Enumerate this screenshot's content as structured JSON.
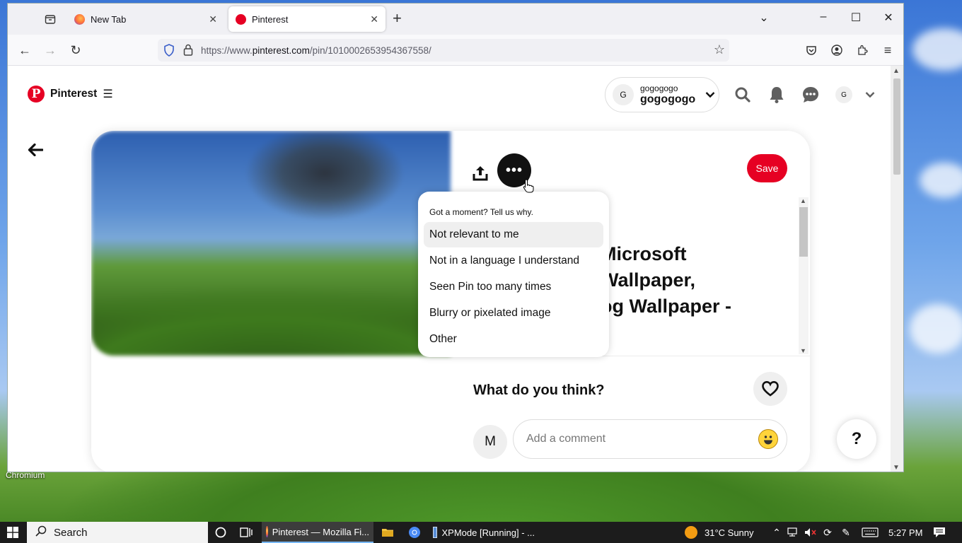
{
  "desktop": {
    "label": "Chromium"
  },
  "browser": {
    "tabs": [
      {
        "title": "New Tab",
        "icon": "firefox-icon",
        "active": false
      },
      {
        "title": "Pinterest",
        "icon": "pinterest-icon",
        "active": true
      }
    ],
    "url_prefix": "https://www.",
    "url_domain": "pinterest.com",
    "url_path": "/pin/1010002653954367558/"
  },
  "header": {
    "logo_text": "Pinterest",
    "account_small": "gogogogo",
    "account_big": "gogogogo",
    "account_initial": "G",
    "profile_initial": "G"
  },
  "pin": {
    "save_label": "Save",
    "title_lines": [
      "Microsoft",
      "Wallpaper,",
      "og Wallpaper -"
    ],
    "feedback_prompt": "What do you think?",
    "commenter_initial": "M",
    "comment_placeholder": "Add a comment",
    "help_label": "?"
  },
  "menu": {
    "hint": "Got a moment? Tell us why.",
    "items": [
      "Not relevant to me",
      "Not in a language I understand",
      "Seen Pin too many times",
      "Blurry or pixelated image",
      "Other"
    ]
  },
  "taskbar": {
    "search_label": "Search",
    "apps": [
      "Pinterest — Mozilla Fi...",
      "XPMode [Running] - ..."
    ],
    "weather": "31°C  Sunny",
    "time": "5:27 PM"
  },
  "colors": {
    "pinterest_red": "#e60023",
    "taskbar": "#1c1c1c"
  }
}
